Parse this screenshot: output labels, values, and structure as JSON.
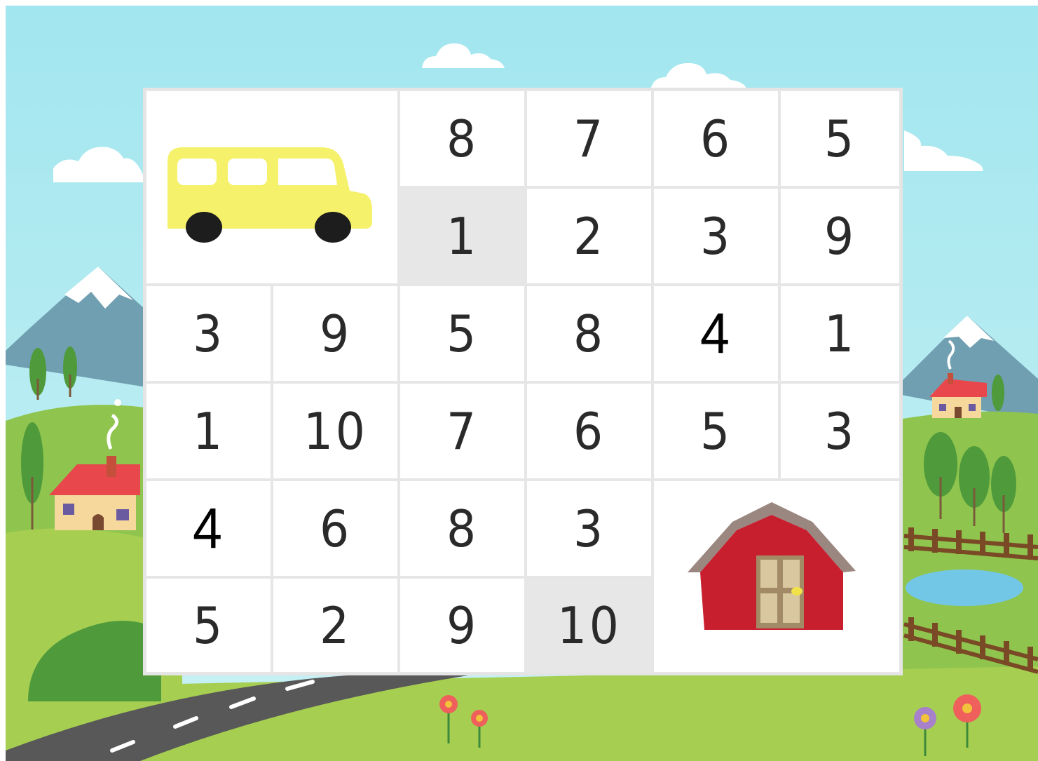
{
  "colors": {
    "sky": "#a2e6ef",
    "grass": "#9bc94a",
    "road": "#585858",
    "bus": "#f5f16a",
    "barn": "#c81f2f",
    "roof": "#9a8780",
    "cell_shaded": "#e7e7e7"
  },
  "maze": {
    "start_icon": "school-bus-icon",
    "finish_icon": "red-barn-icon",
    "rows": [
      [
        "",
        "",
        "8",
        "7",
        "6",
        "5"
      ],
      [
        "",
        "",
        "1",
        "2",
        "3",
        "9"
      ],
      [
        "3",
        "9",
        "5",
        "8",
        "4",
        "1"
      ],
      [
        "1",
        "10",
        "7",
        "6",
        "5",
        "3"
      ],
      [
        "4",
        "6",
        "8",
        "3",
        "",
        ""
      ],
      [
        "5",
        "2",
        "9",
        "10",
        "",
        ""
      ]
    ],
    "shaded": [
      [
        1,
        2
      ],
      [
        5,
        3
      ]
    ],
    "bold": [
      [
        2,
        4
      ],
      [
        4,
        0
      ]
    ]
  }
}
